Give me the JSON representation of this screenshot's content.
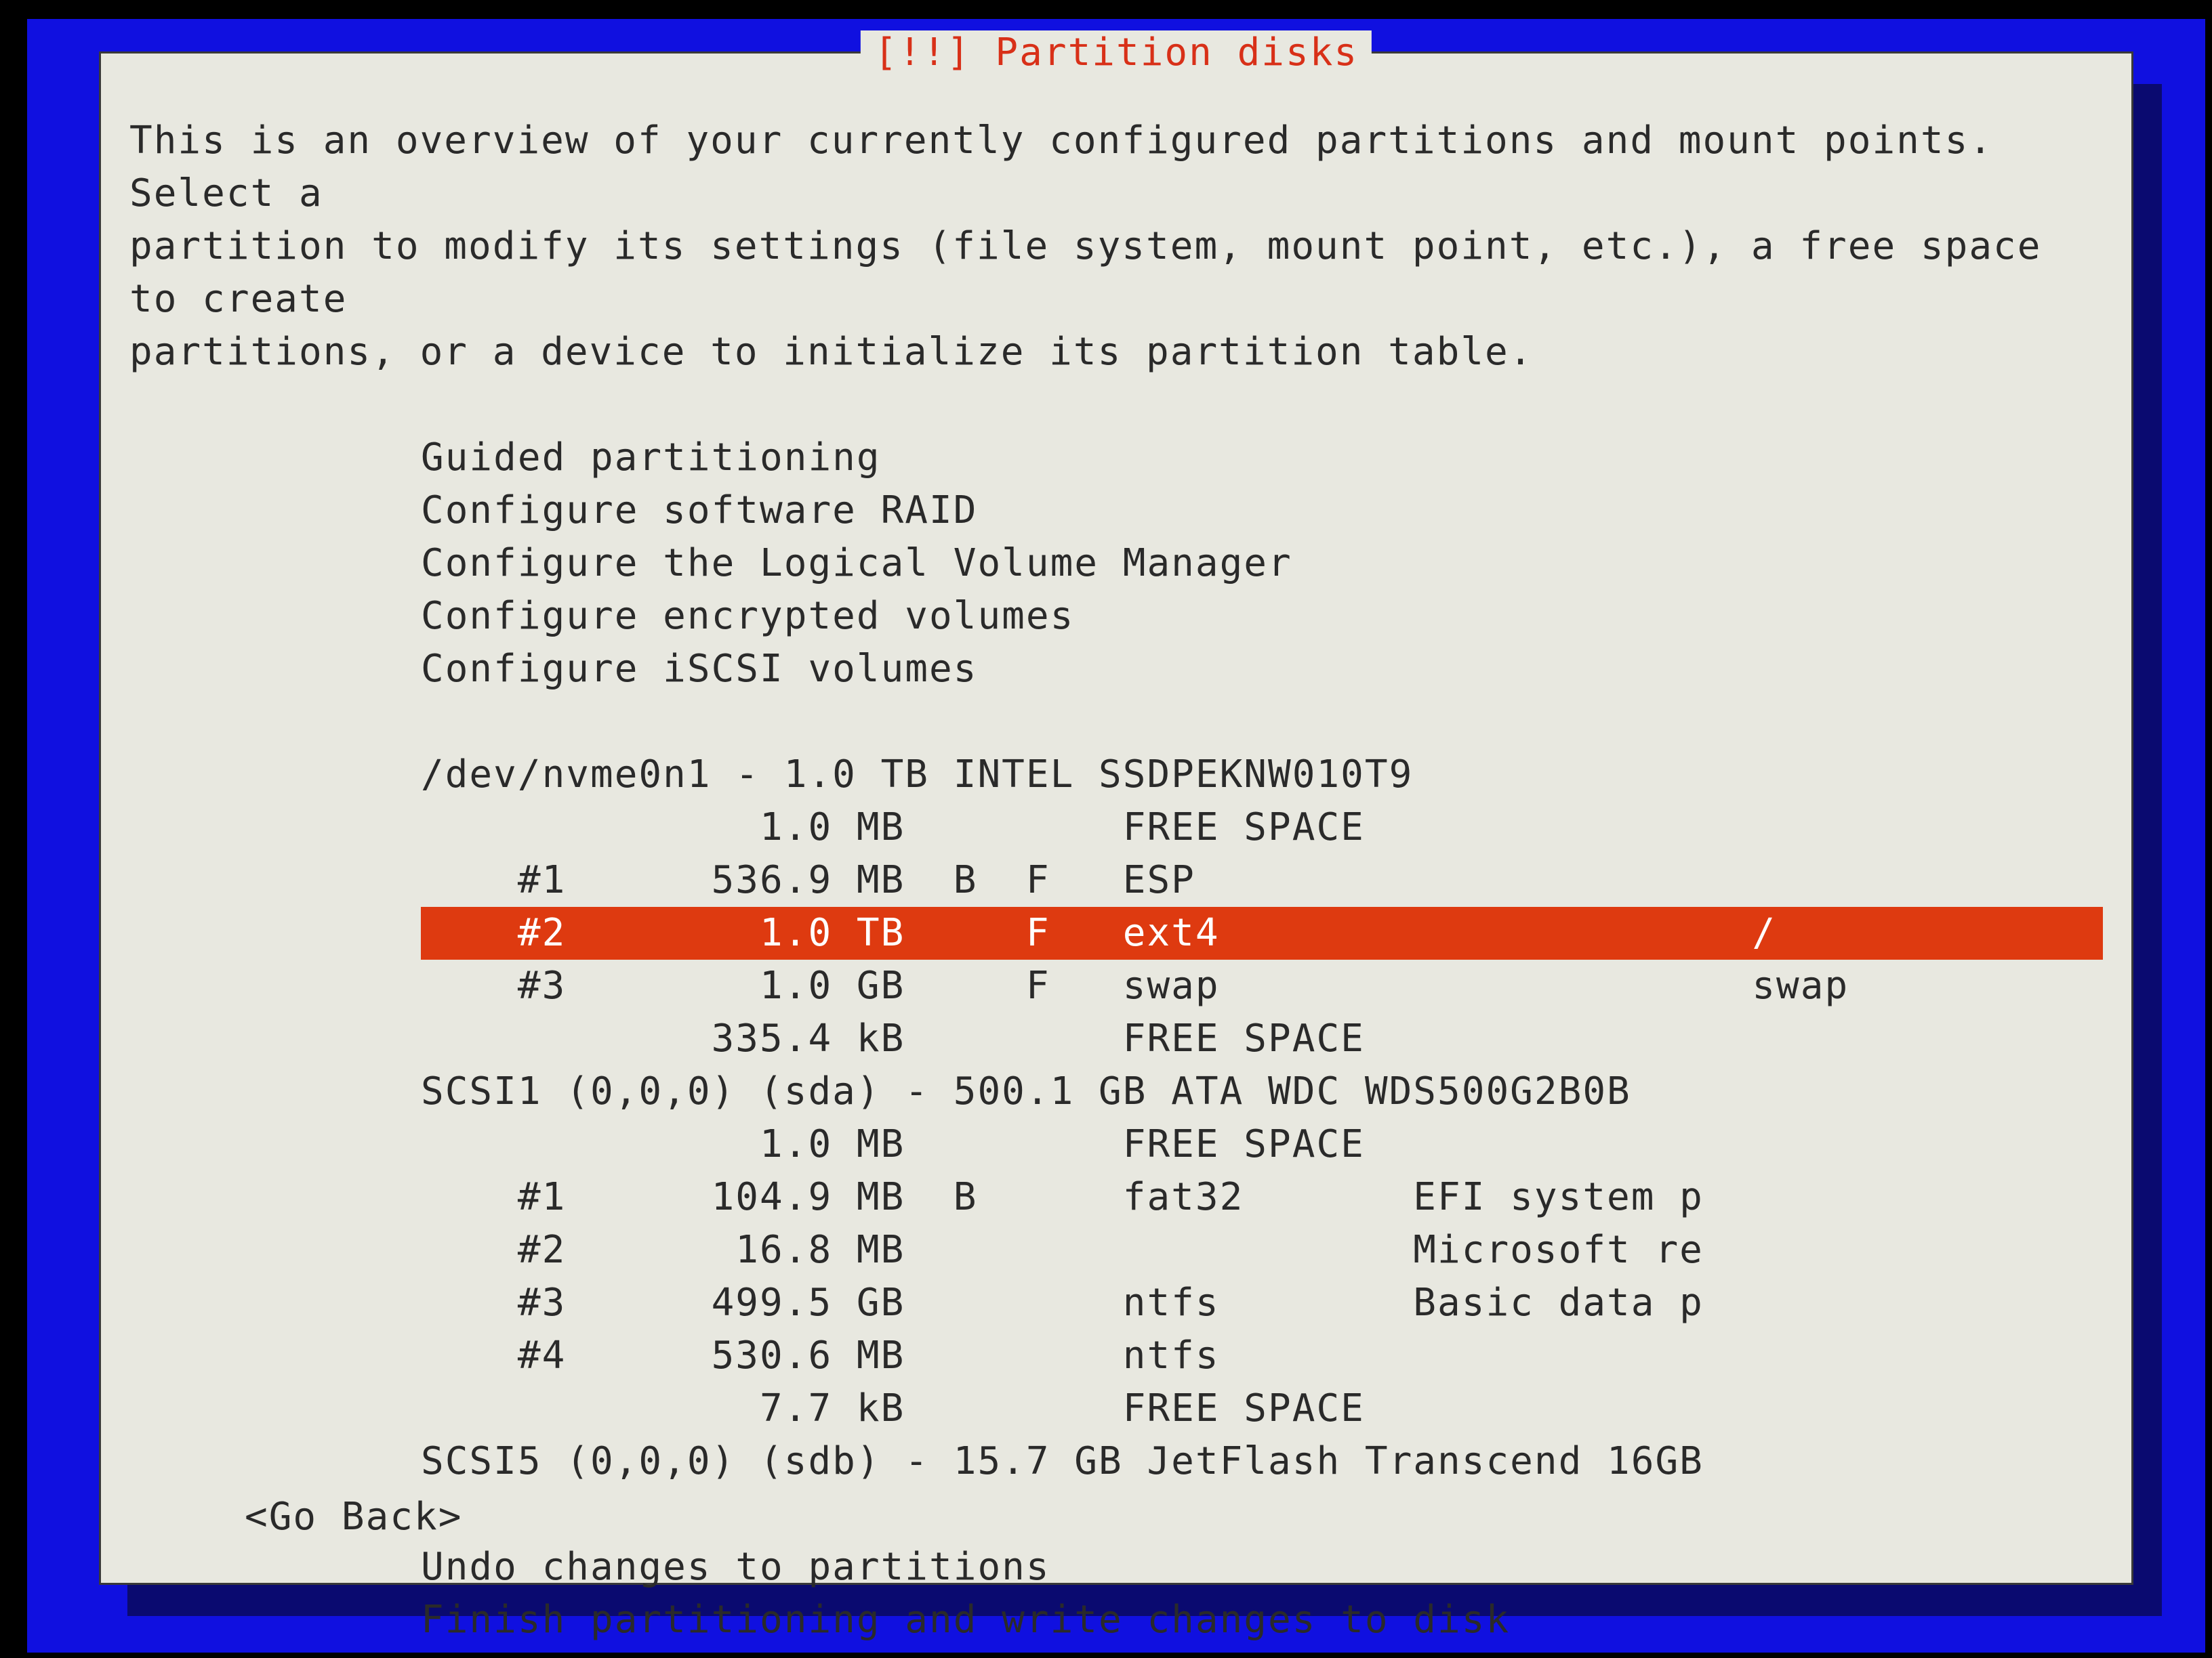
{
  "window_title": "[!!] Partition disks",
  "intro_text": "This is an overview of your currently configured partitions and mount points. Select a\npartition to modify its settings (file system, mount point, etc.), a free space to create\npartitions, or a device to initialize its partition table.",
  "config_actions": {
    "guided": "Guided partitioning",
    "raid": "Configure software RAID",
    "lvm": "Configure the Logical Volume Manager",
    "encrypt": "Configure encrypted volumes",
    "iscsi": "Configure iSCSI volumes"
  },
  "disks": [
    {
      "header": "/dev/nvme0n1 - 1.0 TB INTEL SSDPEKNW010T9",
      "rows": [
        {
          "num": "",
          "size": "1.0 MB",
          "flags": "",
          "fs": "FREE SPACE",
          "name": "",
          "mount": "",
          "selected": false
        },
        {
          "num": "#1",
          "size": "536.9 MB",
          "flags": "B  F",
          "fs": "ESP",
          "name": "",
          "mount": "",
          "selected": false
        },
        {
          "num": "#2",
          "size": "1.0 TB",
          "flags": "   F",
          "fs": "ext4",
          "name": "",
          "mount": "/",
          "selected": true
        },
        {
          "num": "#3",
          "size": "1.0 GB",
          "flags": "   F",
          "fs": "swap",
          "name": "",
          "mount": "swap",
          "selected": false
        },
        {
          "num": "",
          "size": "335.4 kB",
          "flags": "",
          "fs": "FREE SPACE",
          "name": "",
          "mount": "",
          "selected": false
        }
      ]
    },
    {
      "header": "SCSI1 (0,0,0) (sda) - 500.1 GB ATA WDC WDS500G2B0B",
      "rows": [
        {
          "num": "",
          "size": "1.0 MB",
          "flags": "",
          "fs": "FREE SPACE",
          "name": "",
          "mount": "",
          "selected": false
        },
        {
          "num": "#1",
          "size": "104.9 MB",
          "flags": "B",
          "fs": "fat32",
          "name": "EFI system p",
          "mount": "",
          "selected": false
        },
        {
          "num": "#2",
          "size": "16.8 MB",
          "flags": "",
          "fs": "",
          "name": "Microsoft re",
          "mount": "",
          "selected": false
        },
        {
          "num": "#3",
          "size": "499.5 GB",
          "flags": "",
          "fs": "ntfs",
          "name": "Basic data p",
          "mount": "",
          "selected": false
        },
        {
          "num": "#4",
          "size": "530.6 MB",
          "flags": "",
          "fs": "ntfs",
          "name": "",
          "mount": "",
          "selected": false
        },
        {
          "num": "",
          "size": "7.7 kB",
          "flags": "",
          "fs": "FREE SPACE",
          "name": "",
          "mount": "",
          "selected": false
        }
      ]
    },
    {
      "header": "SCSI5 (0,0,0) (sdb) - 15.7 GB JetFlash Transcend 16GB",
      "rows": []
    }
  ],
  "final_actions": {
    "undo": "Undo changes to partitions",
    "finish": "Finish partitioning and write changes to disk"
  },
  "go_back": "<Go Back>"
}
